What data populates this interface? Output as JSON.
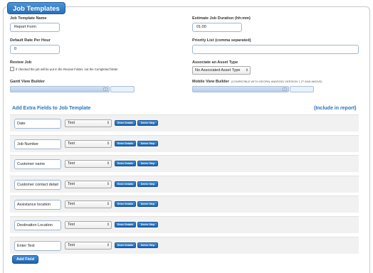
{
  "title": "Job Templates",
  "template_name": {
    "label": "Job Template Name",
    "value": "Report Form"
  },
  "default_rate": {
    "label": "Default Rate Per Hour",
    "value": "0"
  },
  "review_job": {
    "label": "Review Job",
    "checkbox_text": "If checked the job will be put in the Review Folder, not the Completed folder",
    "checked": false
  },
  "gantt_builder": {
    "label": "Gantt View Builder"
  },
  "estimate_duration": {
    "label": "Estimate Job Duration (hh:mm)",
    "value": "01:00"
  },
  "priority_list": {
    "label": "Priority List (comma separated)",
    "value": ""
  },
  "asset_type": {
    "label": "Associate an Asset Type",
    "value": "No Associated Asset Type"
  },
  "mobile_builder": {
    "label": "Mobile View Builder",
    "note": "(COMPATIBLE WITH GEOPAL ANDROID VERSION 1.27 AND ABOVE)"
  },
  "extra_fields": {
    "heading": "Add Extra Fields to Job Template",
    "include_heading": "(Include in report)",
    "enter_details_label": "Enter Details",
    "delete_step_label": "Delete Step",
    "rows": [
      {
        "name": "Date",
        "type": "Text",
        "include": true
      },
      {
        "name": "Job Number",
        "type": "Text",
        "include": true
      },
      {
        "name": "Customer name",
        "type": "Text",
        "include": true
      },
      {
        "name": "Customer contact detail",
        "type": "Text",
        "include": true
      },
      {
        "name": "Assistance location",
        "type": "Text",
        "include": true
      },
      {
        "name": "Destination Location",
        "type": "Text",
        "include": true
      },
      {
        "name": "Enter Text",
        "type": "Text",
        "include": true
      }
    ]
  },
  "add_field_label": "Add Field",
  "icons": {
    "select_caret": "⇕",
    "check": "✓",
    "handle": "≡"
  },
  "colors": {
    "accent": "#2a74bd",
    "button": "#1f62ad"
  }
}
